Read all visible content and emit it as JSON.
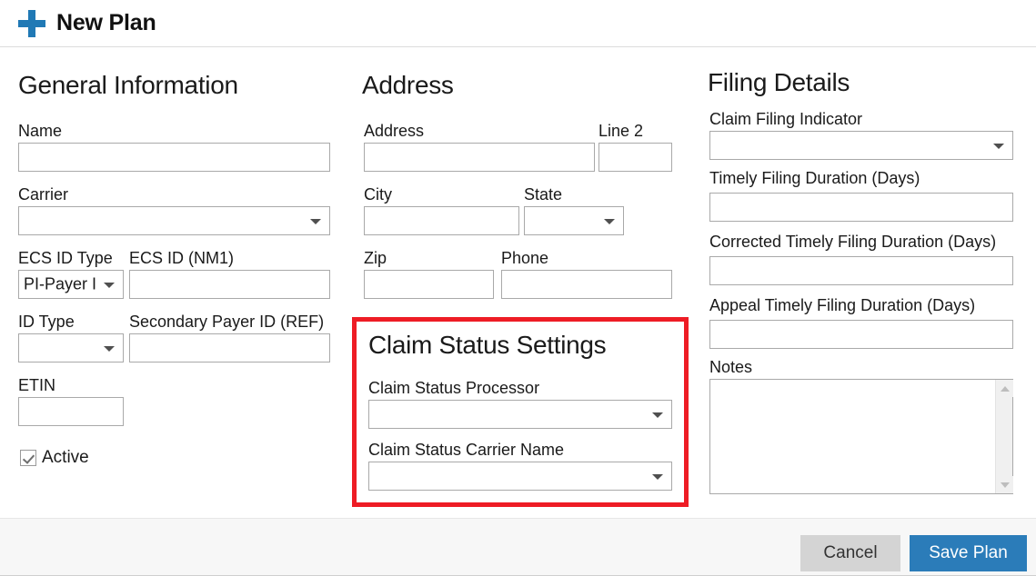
{
  "header": {
    "title": "New Plan",
    "add_icon": "plus-icon"
  },
  "general": {
    "section_title": "General Information",
    "name_label": "Name",
    "name_value": "",
    "carrier_label": "Carrier",
    "carrier_value": "",
    "ecs_id_type_label": "ECS ID Type",
    "ecs_id_type_value": "PI-Payer I",
    "ecs_id_nm1_label": "ECS ID (NM1)",
    "ecs_id_nm1_value": "",
    "id_type_label": "ID Type",
    "id_type_value": "",
    "secondary_payer_label": "Secondary Payer ID (REF)",
    "secondary_payer_value": "",
    "etin_label": "ETIN",
    "etin_value": "",
    "active_label": "Active",
    "active_checked": true
  },
  "address": {
    "section_title": "Address",
    "address_label": "Address",
    "address_value": "",
    "line2_label": "Line 2",
    "line2_value": "",
    "city_label": "City",
    "city_value": "",
    "state_label": "State",
    "state_value": "",
    "zip_label": "Zip",
    "zip_value": "",
    "phone_label": "Phone",
    "phone_value": ""
  },
  "claim_status": {
    "section_title": "Claim Status Settings",
    "processor_label": "Claim Status Processor",
    "processor_value": "",
    "carrier_name_label": "Claim Status Carrier Name",
    "carrier_name_value": "",
    "highlight_color": "#ee1c25"
  },
  "filing": {
    "section_title": "Filing Details",
    "claim_filing_indicator_label": "Claim Filing Indicator",
    "claim_filing_indicator_value": "",
    "timely_filing_label": "Timely Filing Duration (Days)",
    "timely_filing_value": "",
    "corrected_timely_filing_label": "Corrected Timely Filing Duration (Days)",
    "corrected_timely_filing_value": "",
    "appeal_timely_filing_label": "Appeal Timely Filing Duration (Days)",
    "appeal_timely_filing_value": "",
    "notes_label": "Notes",
    "notes_value": "",
    "scroll_up_icon": "triangle-up-icon",
    "scroll_down_icon": "triangle-down-icon"
  },
  "footer": {
    "cancel_label": "Cancel",
    "save_label": "Save Plan",
    "accent_color": "#2b7cb9",
    "cancel_color": "#d4d4d4"
  }
}
